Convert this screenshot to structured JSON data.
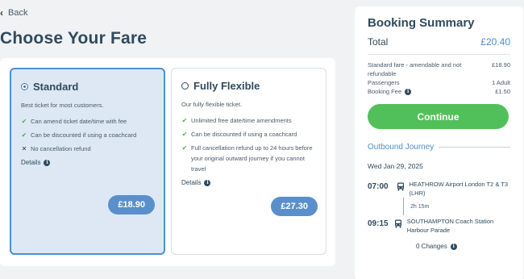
{
  "nav": {
    "back_label": "Back"
  },
  "page": {
    "title": "Choose Your Fare"
  },
  "fares": [
    {
      "name": "Standard",
      "selected": true,
      "description": "Best ticket for most customers.",
      "features": [
        {
          "icon": "check-icon",
          "text": "Can amend ticket date/time with fee"
        },
        {
          "icon": "check-icon",
          "text": "Can be discounted if using a coachcard"
        },
        {
          "icon": "cross-icon",
          "text": "No cancellation refund"
        }
      ],
      "details_label": "Details",
      "price": "£18.90"
    },
    {
      "name": "Fully Flexible",
      "selected": false,
      "description": "Our fully flexible ticket.",
      "features": [
        {
          "icon": "check-icon",
          "text": "Unlimited free date/time amendments"
        },
        {
          "icon": "check-icon",
          "text": "Can be discounted if using a coachcard"
        },
        {
          "icon": "check-icon",
          "text": "Full cancellation refund up to 24 hours before your original outward journey if you cannot travel"
        }
      ],
      "details_label": "Details",
      "price": "£27.30"
    }
  ],
  "summary": {
    "title": "Booking Summary",
    "total_label": "Total",
    "total_value": "£20.40",
    "line_items": [
      {
        "label": "Standard fare - amendable and not refundable",
        "value": "£18.90"
      },
      {
        "label": "Passengers",
        "value": "1 Adult"
      },
      {
        "label": "Booking Fee",
        "value": "£1.50",
        "has_info": true
      }
    ],
    "continue_label": "Continue",
    "outbound_title": "Outbound Journey",
    "date": "Wed Jan 29, 2025",
    "departure": {
      "time": "07:00",
      "place": "HEATHROW Airport London T2 & T3 (LHR)"
    },
    "duration": "2h 15m",
    "arrival": {
      "time": "09:15",
      "place": "SOUTHAMPTON Coach Station Harbour Parade"
    },
    "changes": "0 Changes"
  },
  "colors": {
    "accent": "#4b90cc",
    "continue": "#52c05a",
    "price_pill": "#5a8fcc",
    "selected_bg": "#dde8f4",
    "heading": "#2f4a5e"
  }
}
